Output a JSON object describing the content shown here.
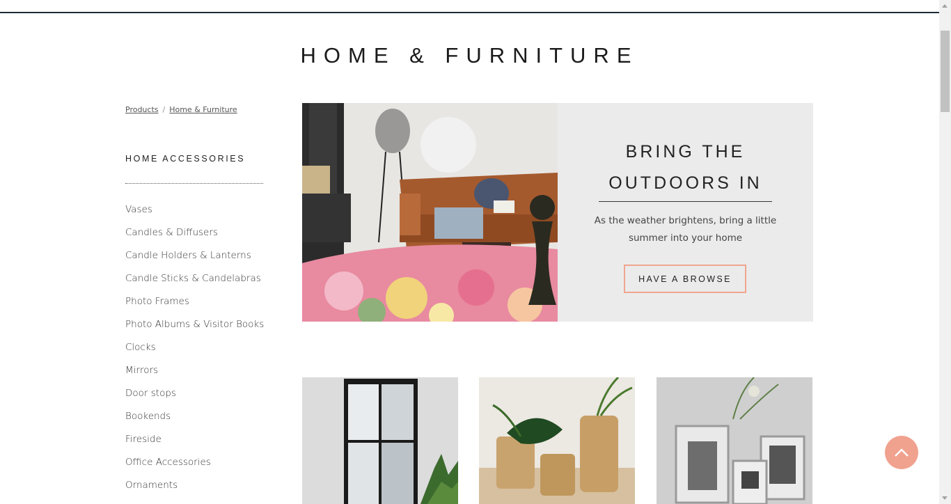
{
  "page": {
    "title": "HOME & FURNITURE"
  },
  "breadcrumb": {
    "items": [
      "Products",
      "Home & Furniture"
    ],
    "separator": "/"
  },
  "sidebar": {
    "heading": "HOME ACCESSORIES",
    "items": [
      "Vases",
      "Candles & Diffusers",
      "Candle Holders & Lanterns",
      "Candle Sticks & Candelabras",
      "Photo Frames",
      "Photo Albums & Visitor Books",
      "Clocks",
      "Mirrors",
      "Door stops",
      "Bookends",
      "Fireside",
      "Office Accessories",
      "Ornaments"
    ]
  },
  "hero": {
    "heading_line1": "BRING THE",
    "heading_line2": "OUTDOORS IN",
    "text": "As the weather brightens, bring a little summer into your home",
    "button_label": "HAVE A BROWSE",
    "image_icon": "living-room-sofa-rug-image"
  },
  "products": [
    {
      "image_icon": "floor-mirror-image"
    },
    {
      "image_icon": "rattan-vases-image"
    },
    {
      "image_icon": "silver-photo-frames-image"
    }
  ],
  "colors": {
    "accent": "#f0a28f",
    "panel": "#ebebeb",
    "header_border": "#1d2a36",
    "text": "#333333"
  },
  "scroll_top": {
    "icon": "chevron-up-icon"
  }
}
